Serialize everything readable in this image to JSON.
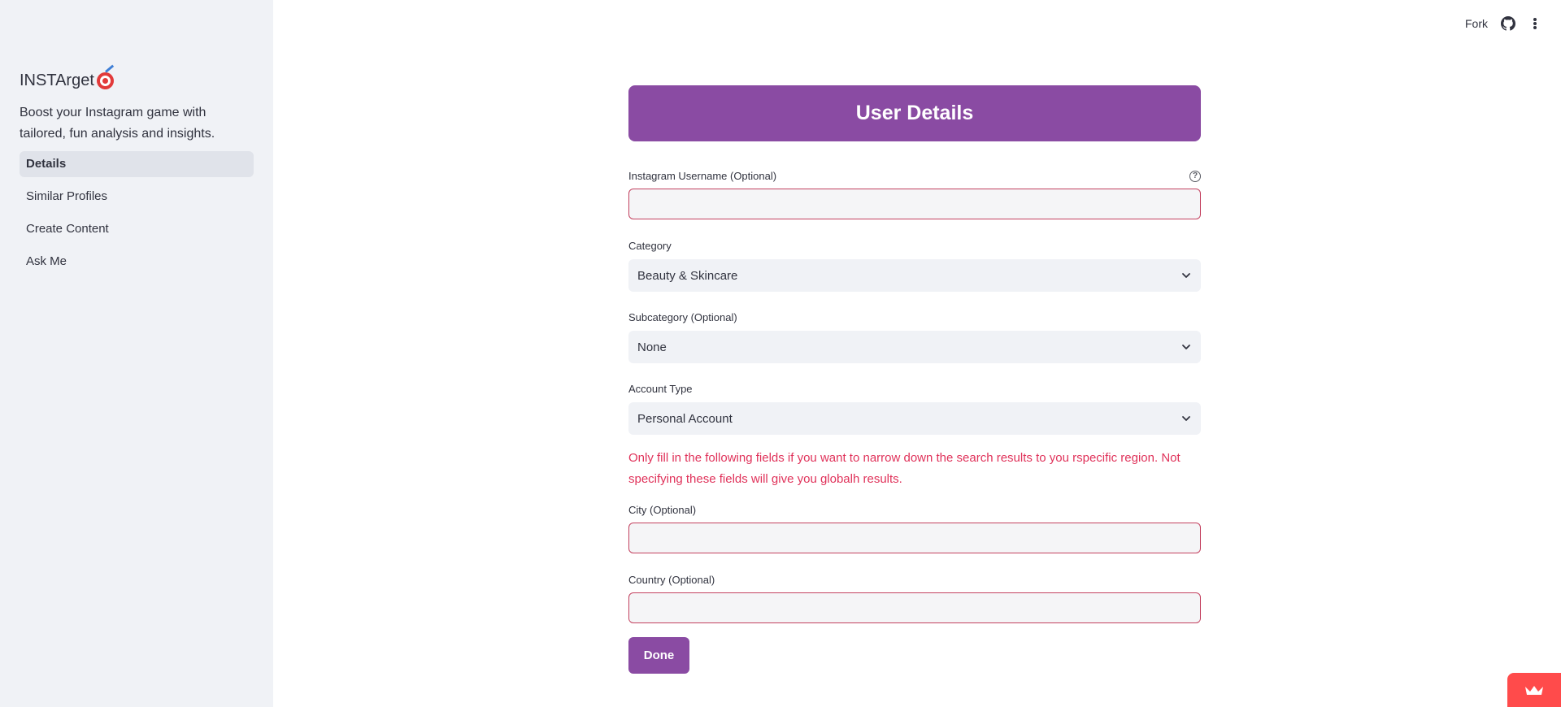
{
  "sidebar": {
    "brand": "INSTArget",
    "brand_icon": "direct-hit-icon",
    "tagline": "Boost your Instagram game with tailored, fun analysis and insights.",
    "items": [
      {
        "label": "Details",
        "active": true
      },
      {
        "label": "Similar Profiles",
        "active": false
      },
      {
        "label": "Create Content",
        "active": false
      },
      {
        "label": "Ask Me",
        "active": false
      }
    ]
  },
  "topbar": {
    "fork_label": "Fork",
    "github_icon": "github-icon",
    "menu_icon": "kebab-menu-icon"
  },
  "form": {
    "title": "User Details",
    "username": {
      "label": "Instagram Username (Optional)",
      "value": "",
      "help_icon": "help-circle-icon"
    },
    "category": {
      "label": "Category",
      "value": "Beauty & Skincare"
    },
    "subcategory": {
      "label": "Subcategory (Optional)",
      "value": "None"
    },
    "account_type": {
      "label": "Account Type",
      "value": "Personal Account"
    },
    "notice": "Only fill in the following fields if you want to narrow down the search results to you rspecific region. Not specifying these fields will give you globalh results.",
    "city": {
      "label": "City (Optional)",
      "value": ""
    },
    "country": {
      "label": "Country (Optional)",
      "value": ""
    },
    "done_label": "Done"
  },
  "colors": {
    "accent": "#8a4ba3",
    "error_text": "#e0325a",
    "input_border": "#c3415f",
    "sidebar_bg": "#f0f2f6",
    "badge": "#ff4b4b"
  }
}
